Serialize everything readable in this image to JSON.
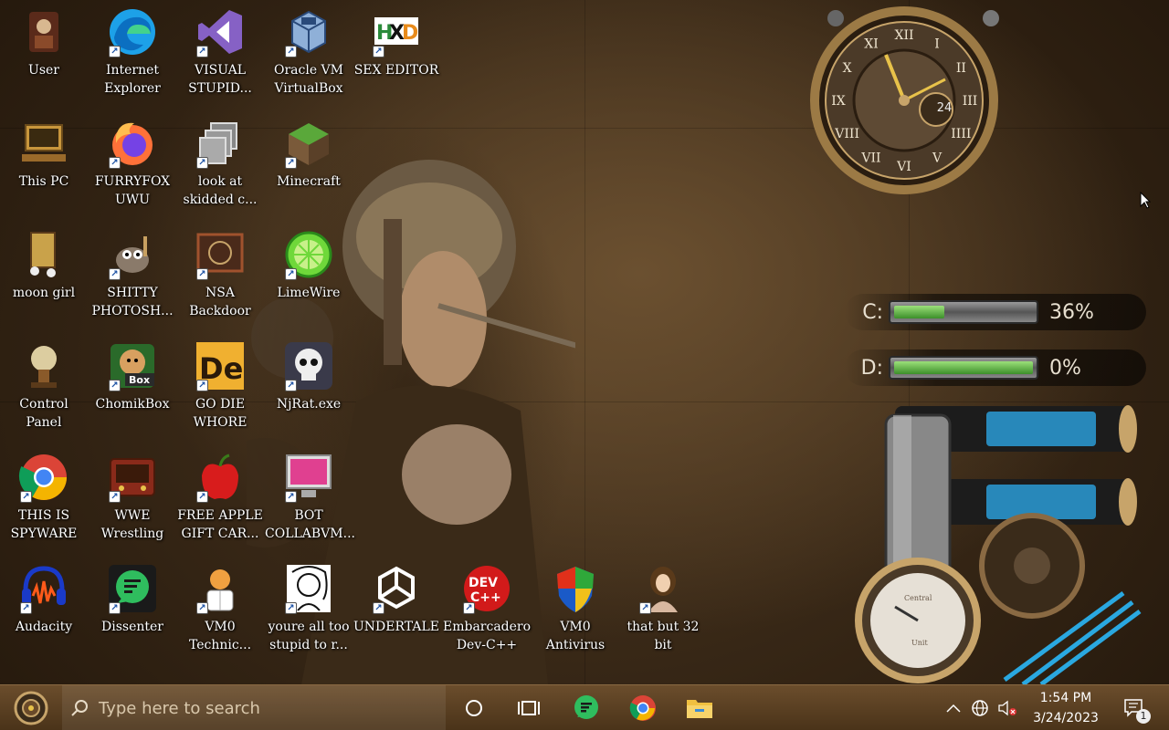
{
  "desktop": {
    "icons": [
      {
        "label": "User",
        "icon": "user-folder-icon"
      },
      {
        "label": "Internet\nExplorer",
        "icon": "edge-browser-icon"
      },
      {
        "label": "VISUAL\nSTUPID...",
        "icon": "visual-studio-icon"
      },
      {
        "label": "Oracle VM\nVirtualBox",
        "icon": "virtualbox-icon"
      },
      {
        "label": "SEX EDITOR",
        "icon": "hex-editor-icon"
      },
      {
        "label": "This PC",
        "icon": "computer-icon"
      },
      {
        "label": "FURRYFOX\nUWU",
        "icon": "firefox-icon"
      },
      {
        "label": "look at\nskidded c...",
        "icon": "copy-windows-icon"
      },
      {
        "label": "Minecraft",
        "icon": "grass-block-icon"
      },
      {
        "label": "moon girl",
        "icon": "moon-girl-icon"
      },
      {
        "label": "SHITTY\nPHOTOSH...",
        "icon": "gimp-icon"
      },
      {
        "label": "NSA\nBackdoor",
        "icon": "steampunk-frame-icon"
      },
      {
        "label": "LimeWire",
        "icon": "limewire-icon"
      },
      {
        "label": "Control Panel",
        "icon": "lamp-icon"
      },
      {
        "label": "ChomikBox",
        "icon": "hamster-box-icon"
      },
      {
        "label": "GO DIE\nWHORE",
        "icon": "de-badge-icon"
      },
      {
        "label": "NjRat.exe",
        "icon": "skull-icon"
      },
      {
        "label": "THIS IS\nSPYWARE",
        "icon": "chrome-icon"
      },
      {
        "label": "WWE\nWrestling",
        "icon": "radio-icon"
      },
      {
        "label": "FREE APPLE\nGIFT CAR...",
        "icon": "apple-icon"
      },
      {
        "label": "BOT\nCOLLABVM...",
        "icon": "monitor-icon"
      },
      {
        "label": "Audacity",
        "icon": "audacity-icon"
      },
      {
        "label": "Dissenter",
        "icon": "chat-bubble-icon"
      },
      {
        "label": "VM0\nTechnic...",
        "icon": "doctor-icon"
      },
      {
        "label": "youre all too\nstupid to r...",
        "icon": "portrait-sketch-icon"
      },
      {
        "label": "UNDERTALE",
        "icon": "unity-icon"
      },
      {
        "label": "Embarcadero\nDev-C++",
        "icon": "devcpp-icon"
      },
      {
        "label": "VM0\nAntivirus",
        "icon": "windows-shield-icon"
      },
      {
        "label": "that but 32\nbit",
        "icon": "lady-portrait-icon"
      }
    ]
  },
  "widgets": {
    "clock": {
      "numerals": [
        "XII",
        "I",
        "II",
        "III",
        "IIII",
        "V",
        "VI",
        "VII",
        "VIII",
        "IX",
        "X",
        "XI"
      ],
      "subdial": "24"
    },
    "drives": [
      {
        "letter": "C:",
        "percent": "36%",
        "fill": 0.36
      },
      {
        "letter": "D:",
        "percent": "0%",
        "fill": 1.0
      }
    ],
    "gauge": {
      "brand": "Central",
      "unit": "Unit"
    }
  },
  "taskbar": {
    "search_placeholder": "Type here to search",
    "time": "1:54 PM",
    "date": "3/24/2023",
    "notification_count": "1"
  },
  "colors": {
    "taskbar": "#5a3f22",
    "accent": "#1a4fa3"
  }
}
